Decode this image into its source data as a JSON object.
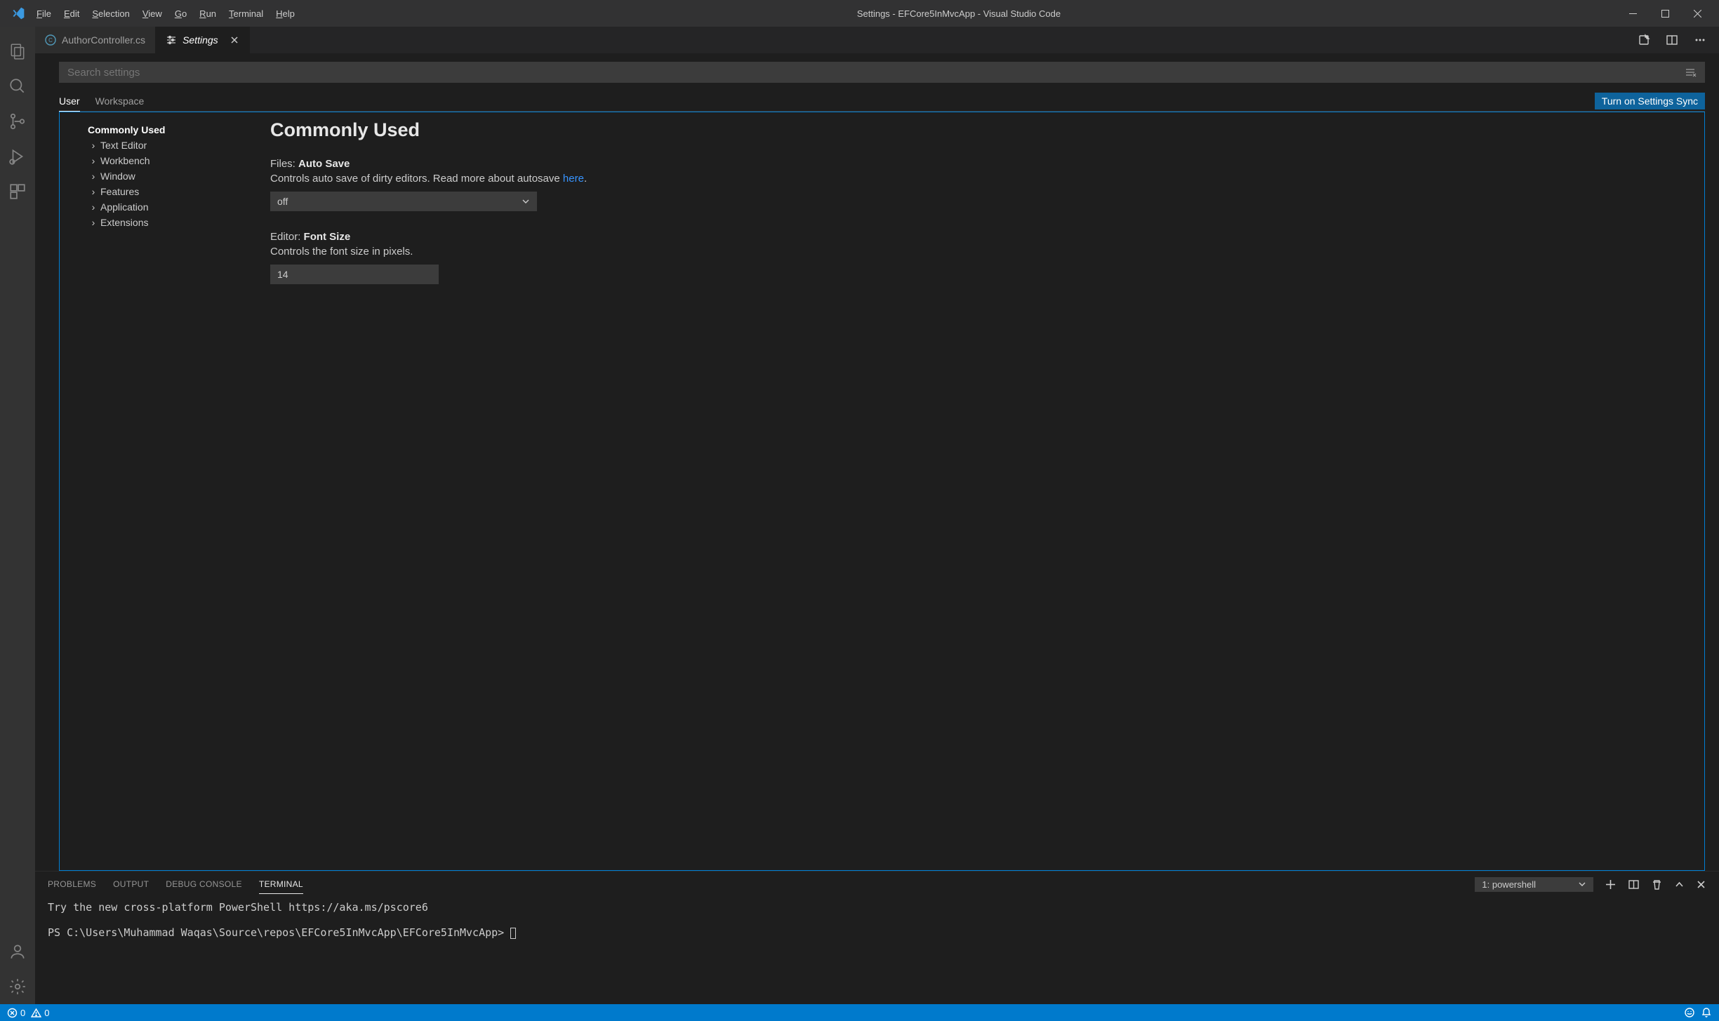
{
  "titlebar": {
    "menus": [
      "File",
      "Edit",
      "Selection",
      "View",
      "Go",
      "Run",
      "Terminal",
      "Help"
    ],
    "title": "Settings - EFCore5InMvcApp - Visual Studio Code"
  },
  "tabs": {
    "t0": {
      "label": "AuthorController.cs"
    },
    "t1": {
      "label": "Settings"
    }
  },
  "search": {
    "placeholder": "Search settings"
  },
  "scopes": {
    "user": "User",
    "workspace": "Workspace",
    "sync": "Turn on Settings Sync"
  },
  "tree": {
    "commonly": "Commonly Used",
    "text": "Text Editor",
    "workbench": "Workbench",
    "window": "Window",
    "features": "Features",
    "application": "Application",
    "extensions": "Extensions"
  },
  "settings": {
    "heading": "Commonly Used",
    "autosave": {
      "scope": "Files:",
      "name": "Auto Save",
      "desc_pre": "Controls auto save of dirty editors. Read more about autosave ",
      "desc_link": "here",
      "desc_post": ".",
      "value": "off"
    },
    "fontsize": {
      "scope": "Editor:",
      "name": "Font Size",
      "desc": "Controls the font size in pixels.",
      "value": "14"
    }
  },
  "panel": {
    "tabs": {
      "problems": "PROBLEMS",
      "output": "OUTPUT",
      "debug": "DEBUG CONSOLE",
      "terminal": "TERMINAL"
    },
    "shell": "1: powershell",
    "line1": "Try the new cross-platform PowerShell https://aka.ms/pscore6",
    "line2": "PS C:\\Users\\Muhammad Waqas\\Source\\repos\\EFCore5InMvcApp\\EFCore5InMvcApp> "
  },
  "status": {
    "errors": "0",
    "warnings": "0"
  }
}
